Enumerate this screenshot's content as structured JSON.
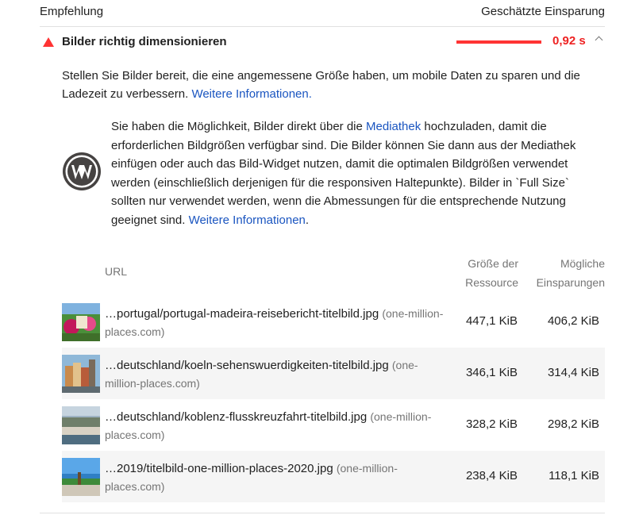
{
  "header": {
    "left": "Empfehlung",
    "right": "Geschätzte Einsparung"
  },
  "audit": {
    "title": "Bilder richtig dimensionieren",
    "value": "0,92 s",
    "status_color": "#ff3333",
    "icons": {
      "status": "warning-triangle-icon",
      "toggle": "chevron-up-icon"
    }
  },
  "description": {
    "text": "Stellen Sie Bilder bereit, die eine angemessene Größe haben, um mobile Daten zu sparen und die Ladezeit zu verbessern.",
    "link": "Weitere Informationen."
  },
  "stack_note": {
    "icon": "wordpress-logo-icon",
    "part1": "Sie haben die Möglichkeit, Bilder direkt über die",
    "link1": "Mediathek",
    "part2": "hochzuladen, damit die erforderlichen Bildgrößen verfügbar sind. Die Bilder können Sie dann aus der Mediathek einfügen oder auch das Bild-Widget nutzen, damit die optimalen Bildgrößen verwendet werden (einschließlich derjenigen für die responsiven Haltepunkte). Bilder in `Full Size` sollten nur verwendet werden, wenn die Abmessungen für die entsprechende Nutzung geeignet sind.",
    "link2": "Weitere Informationen",
    "period": "."
  },
  "table": {
    "col_url": "URL",
    "col_size": [
      "Größe der",
      "Ressource"
    ],
    "col_savings": [
      "Mögliche",
      "Einsparungen"
    ],
    "rows": [
      {
        "path": "…portugal/portugal-madeira-reisebericht-titelbild.jpg",
        "host": "(one-million-places.com)",
        "size": "447,1 KiB",
        "savings": "406,2 KiB"
      },
      {
        "path": "…deutschland/koeln-sehenswuerdigkeiten-titelbild.jpg",
        "host": "(one-million-places.com)",
        "size": "346,1 KiB",
        "savings": "314,4 KiB"
      },
      {
        "path": "…deutschland/koblenz-flusskreuzfahrt-titelbild.jpg",
        "host": "(one-million-places.com)",
        "size": "328,2 KiB",
        "savings": "298,2 KiB"
      },
      {
        "path": "…2019/titelbild-one-million-places-2020.jpg",
        "host": "(one-million-places.com)",
        "size": "238,4 KiB",
        "savings": "118,1 KiB"
      }
    ]
  }
}
